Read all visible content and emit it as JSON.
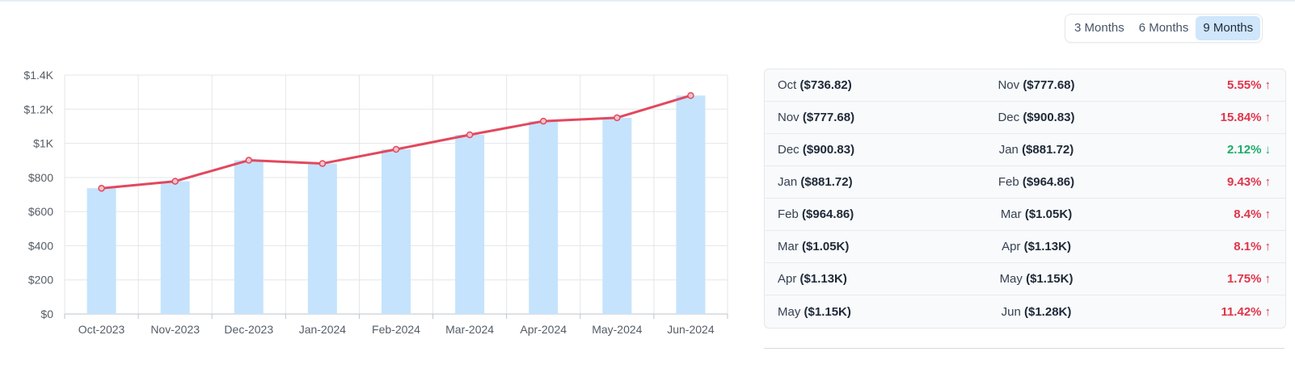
{
  "range_selector": {
    "options": [
      "3 Months",
      "6 Months",
      "9 Months"
    ],
    "selected": "9 Months"
  },
  "chart_data": {
    "type": "bar",
    "categories": [
      "Oct-2023",
      "Nov-2023",
      "Dec-2023",
      "Jan-2024",
      "Feb-2024",
      "Mar-2024",
      "Apr-2024",
      "May-2024",
      "Jun-2024"
    ],
    "series": [
      {
        "type": "bar",
        "values": [
          736.82,
          777.68,
          900.83,
          881.72,
          964.86,
          1050,
          1130,
          1150,
          1280
        ],
        "color": "#c5e3fc"
      },
      {
        "type": "line",
        "values": [
          736.82,
          777.68,
          900.83,
          881.72,
          964.86,
          1050,
          1130,
          1150,
          1280
        ],
        "color": "#e2485e"
      }
    ],
    "y_ticks": [
      "$0",
      "$200",
      "$400",
      "$600",
      "$800",
      "$1K",
      "$1.2K",
      "$1.4K"
    ],
    "ylim": [
      0,
      1400
    ],
    "grid": true
  },
  "comparison": [
    {
      "from_month": "Oct",
      "from_value": "($736.82)",
      "to_month": "Nov",
      "to_value": "($777.68)",
      "change": "5.55%",
      "direction": "up"
    },
    {
      "from_month": "Nov",
      "from_value": "($777.68)",
      "to_month": "Dec",
      "to_value": "($900.83)",
      "change": "15.84%",
      "direction": "up"
    },
    {
      "from_month": "Dec",
      "from_value": "($900.83)",
      "to_month": "Jan",
      "to_value": "($881.72)",
      "change": "2.12%",
      "direction": "down"
    },
    {
      "from_month": "Jan",
      "from_value": "($881.72)",
      "to_month": "Feb",
      "to_value": "($964.86)",
      "change": "9.43%",
      "direction": "up"
    },
    {
      "from_month": "Feb",
      "from_value": "($964.86)",
      "to_month": "Mar",
      "to_value": "($1.05K)",
      "change": "8.4%",
      "direction": "up"
    },
    {
      "from_month": "Mar",
      "from_value": "($1.05K)",
      "to_month": "Apr",
      "to_value": "($1.13K)",
      "change": "8.1%",
      "direction": "up"
    },
    {
      "from_month": "Apr",
      "from_value": "($1.13K)",
      "to_month": "May",
      "to_value": "($1.15K)",
      "change": "1.75%",
      "direction": "up"
    },
    {
      "from_month": "May",
      "from_value": "($1.15K)",
      "to_month": "Jun",
      "to_value": "($1.28K)",
      "change": "11.42%",
      "direction": "up"
    }
  ]
}
